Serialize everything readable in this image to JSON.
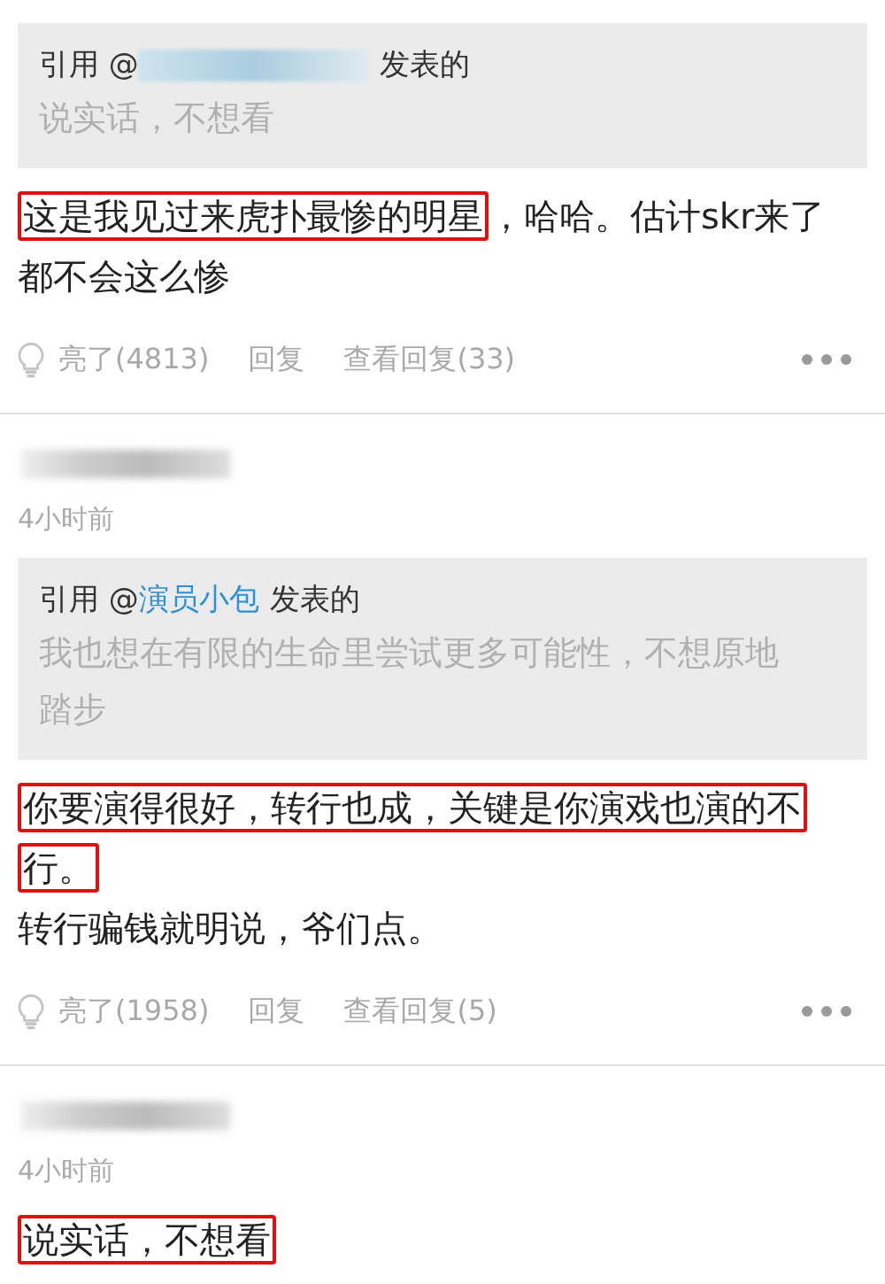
{
  "comments": [
    {
      "quote": {
        "prefix": "引用 @",
        "author_hidden": true,
        "suffix": " 发表的",
        "text": "说实话，不想看"
      },
      "paragraphs": [
        [
          {
            "text": "这是我见过来虎扑最惨的明星",
            "highlighted": true
          },
          {
            "text": "，哈哈。估计skr来了都不会这么惨",
            "highlighted": false
          }
        ]
      ],
      "actions": {
        "likes": "亮了(4813)",
        "reply": "回复",
        "view_replies": "查看回复(33)"
      }
    },
    {
      "author_hidden": true,
      "time": "4小时前",
      "quote": {
        "prefix": "引用 @",
        "author": "演员小包",
        "suffix": " 发表的",
        "text": "我也想在有限的生命里尝试更多可能性，不想原地踏步"
      },
      "paragraphs": [
        [
          {
            "text": "你要演得很好，转行也成，关键是你演戏也演的不行。",
            "highlighted": true
          }
        ],
        [
          {
            "text": "转行骗钱就明说，爷们点。",
            "highlighted": false
          }
        ]
      ],
      "actions": {
        "likes": "亮了(1958)",
        "reply": "回复",
        "view_replies": "查看回复(5)"
      }
    },
    {
      "author_hidden": true,
      "time": "4小时前",
      "paragraphs": [
        [
          {
            "text": "说实话，不想看",
            "highlighted": true
          }
        ]
      ]
    }
  ]
}
